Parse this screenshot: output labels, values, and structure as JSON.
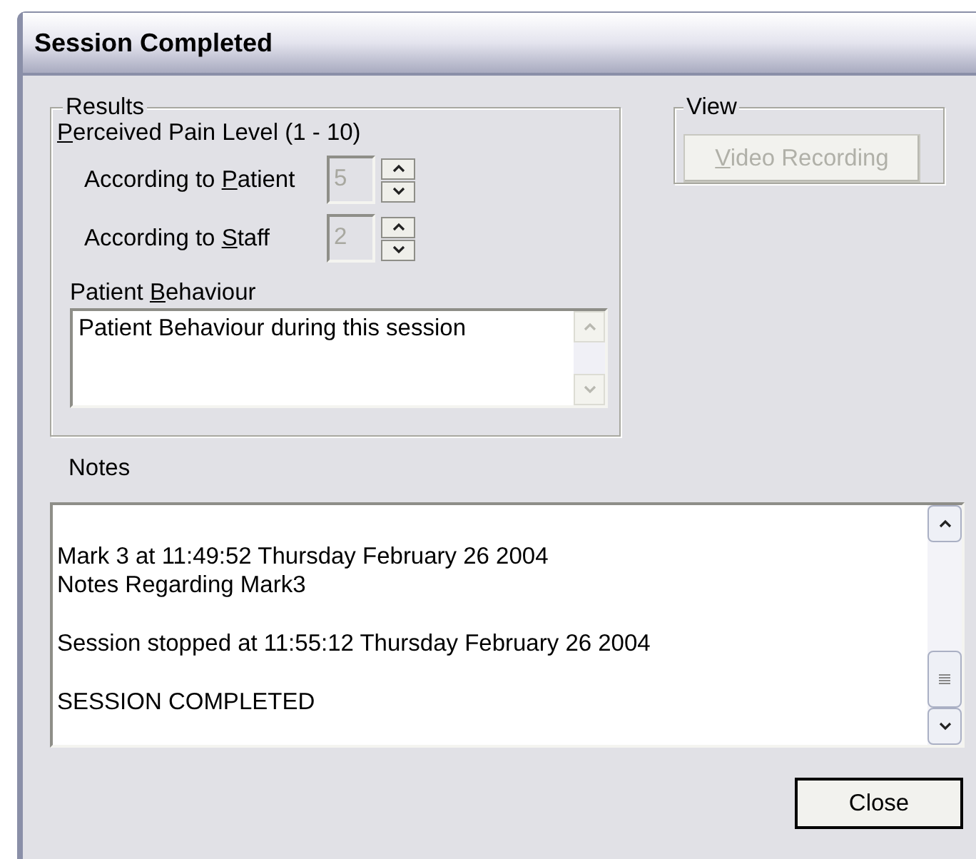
{
  "window": {
    "title": "Session Completed"
  },
  "results": {
    "title": "Results",
    "pain_label": {
      "mnemonic": "P",
      "after": "erceived Pain Level (1 - 10)"
    },
    "spinners": [
      {
        "label": {
          "before": "According to ",
          "mnemonic": "P",
          "after": "atient"
        },
        "value": "5",
        "disabled": true
      },
      {
        "label": {
          "before": "According to ",
          "mnemonic": "S",
          "after": "taff"
        },
        "value": "2",
        "disabled": true
      }
    ],
    "behaviour": {
      "label": {
        "before": "Patient ",
        "mnemonic": "B",
        "after": "ehaviour"
      },
      "value": "Patient Behaviour during this session",
      "disabled": true
    }
  },
  "view": {
    "title": "View",
    "button": {
      "label": {
        "mnemonic": "V",
        "after": "ideo Recording"
      },
      "disabled": true
    }
  },
  "notes": {
    "label": "Notes",
    "paragraphs": [
      [
        "Mark 3 at 11:49:52 Thursday February 26 2004",
        "Notes Regarding Mark3"
      ],
      [
        "Session stopped at 11:55:12 Thursday February 26 2004"
      ],
      [
        "SESSION COMPLETED"
      ]
    ]
  },
  "buttons": [
    {
      "label": "Close"
    }
  ]
}
